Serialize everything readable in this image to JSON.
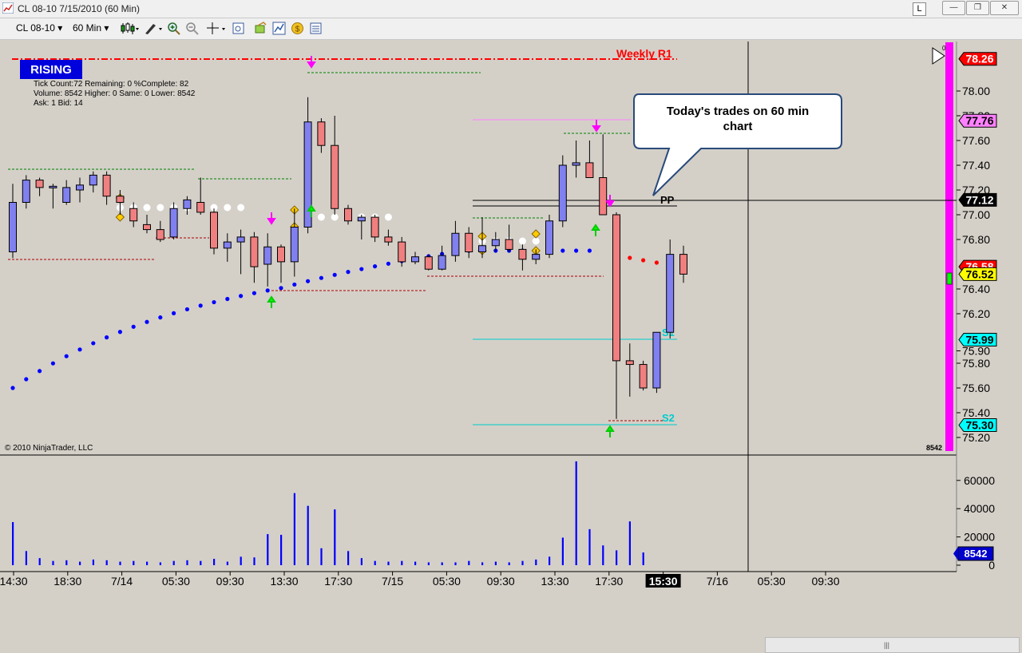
{
  "window": {
    "title": "CL 08-10  7/15/2010 (60 Min)",
    "l_button": "L",
    "minimize": "—",
    "restore": "❐",
    "close": "✕"
  },
  "toolbar": {
    "instrument": "CL 08-10",
    "interval": "60 Min"
  },
  "chart": {
    "rising_label": "RISING",
    "stats": [
      "Tick Count:72   Remaining: 0   %Complete: 82",
      "Volume: 8542   Higher: 0   Same: 0   Lower: 8542",
      "Ask: 1   Bid: 14"
    ],
    "copyright": "© 2010 NinjaTrader, LLC",
    "callout": "Today's trades on 60 min chart",
    "level_labels": {
      "weekly_r1": "Weekly R1",
      "pp": "PP",
      "s1": "S1",
      "s2": "S2"
    },
    "bar_counter": "8542",
    "volume_badge": "8542",
    "price_badges": [
      {
        "text": "78.26",
        "bg": "#ff0000",
        "fg": "#ffffff"
      },
      {
        "text": "77.76",
        "bg": "#ff80ff",
        "fg": "#000000"
      },
      {
        "text": "77.12",
        "bg": "#000000",
        "fg": "#ffffff"
      },
      {
        "text": "76.58",
        "bg": "#ff0000",
        "fg": "#ffffff"
      },
      {
        "text": "76.52",
        "bg": "#ffff00",
        "fg": "#000000"
      },
      {
        "text": "75.99",
        "bg": "#00ffff",
        "fg": "#000000"
      },
      {
        "text": "75.30",
        "bg": "#00ffff",
        "fg": "#000000"
      }
    ],
    "price_ticks": [
      "78.00",
      "77.80",
      "77.60",
      "77.40",
      "77.20",
      "77.00",
      "76.80",
      "76.40",
      "76.20",
      "75.90",
      "75.80",
      "75.60",
      "75.40",
      "75.20"
    ],
    "volume_ticks": [
      "60000",
      "40000",
      "20000",
      "0"
    ],
    "time_ticks": [
      "14:30",
      "18:30",
      "7/14",
      "05:30",
      "09:30",
      "13:30",
      "17:30",
      "7/15",
      "05:30",
      "09:30",
      "13:30",
      "17:30",
      "15:30",
      "7/16",
      "05:30",
      "09:30"
    ],
    "colors": {
      "up_body": "#8080f0",
      "down_body": "#f08080",
      "magenta_bar": "#ff00ff",
      "volume": "#0000ff",
      "psar_blue": "#0000ff",
      "psar_red": "#ff0000"
    }
  },
  "chart_data": {
    "type": "candlestick",
    "instrument": "CL 08-10",
    "interval": "60 Min",
    "candles": [
      {
        "o": 76.7,
        "h": 77.25,
        "l": 76.65,
        "c": 77.1
      },
      {
        "o": 77.1,
        "h": 77.32,
        "l": 77.05,
        "c": 77.28
      },
      {
        "o": 77.28,
        "h": 77.3,
        "l": 77.15,
        "c": 77.22
      },
      {
        "o": 77.22,
        "h": 77.25,
        "l": 77.05,
        "c": 77.23
      },
      {
        "o": 77.1,
        "h": 77.28,
        "l": 77.08,
        "c": 77.22
      },
      {
        "o": 77.2,
        "h": 77.3,
        "l": 77.1,
        "c": 77.24
      },
      {
        "o": 77.24,
        "h": 77.35,
        "l": 77.18,
        "c": 77.32
      },
      {
        "o": 77.32,
        "h": 77.35,
        "l": 77.08,
        "c": 77.15
      },
      {
        "o": 77.15,
        "h": 77.2,
        "l": 77.0,
        "c": 77.1
      },
      {
        "o": 77.05,
        "h": 77.1,
        "l": 76.9,
        "c": 76.95
      },
      {
        "o": 76.92,
        "h": 77.0,
        "l": 76.85,
        "c": 76.88
      },
      {
        "o": 76.88,
        "h": 76.95,
        "l": 76.78,
        "c": 76.8
      },
      {
        "o": 76.82,
        "h": 77.1,
        "l": 76.8,
        "c": 77.05
      },
      {
        "o": 77.05,
        "h": 77.15,
        "l": 77.0,
        "c": 77.12
      },
      {
        "o": 77.1,
        "h": 77.3,
        "l": 77.0,
        "c": 77.02
      },
      {
        "o": 77.02,
        "h": 77.05,
        "l": 76.68,
        "c": 76.73
      },
      {
        "o": 76.73,
        "h": 76.85,
        "l": 76.62,
        "c": 76.78
      },
      {
        "o": 76.78,
        "h": 76.88,
        "l": 76.52,
        "c": 76.82
      },
      {
        "o": 76.82,
        "h": 76.86,
        "l": 76.45,
        "c": 76.58
      },
      {
        "o": 76.6,
        "h": 76.85,
        "l": 76.42,
        "c": 76.74
      },
      {
        "o": 76.74,
        "h": 76.76,
        "l": 76.45,
        "c": 76.62
      },
      {
        "o": 76.62,
        "h": 77.05,
        "l": 76.5,
        "c": 76.9
      },
      {
        "o": 76.9,
        "h": 77.95,
        "l": 76.85,
        "c": 77.75
      },
      {
        "o": 77.75,
        "h": 77.78,
        "l": 77.5,
        "c": 77.56
      },
      {
        "o": 77.56,
        "h": 77.8,
        "l": 77.0,
        "c": 77.05
      },
      {
        "o": 77.05,
        "h": 77.08,
        "l": 76.92,
        "c": 76.95
      },
      {
        "o": 76.95,
        "h": 77.0,
        "l": 76.8,
        "c": 76.98
      },
      {
        "o": 76.98,
        "h": 77.0,
        "l": 76.78,
        "c": 76.82
      },
      {
        "o": 76.82,
        "h": 76.88,
        "l": 76.75,
        "c": 76.78
      },
      {
        "o": 76.78,
        "h": 76.82,
        "l": 76.58,
        "c": 76.62
      },
      {
        "o": 76.62,
        "h": 76.7,
        "l": 76.6,
        "c": 76.66
      },
      {
        "o": 76.66,
        "h": 76.68,
        "l": 76.55,
        "c": 76.56
      },
      {
        "o": 76.56,
        "h": 76.75,
        "l": 76.55,
        "c": 76.67
      },
      {
        "o": 76.67,
        "h": 76.95,
        "l": 76.62,
        "c": 76.85
      },
      {
        "o": 76.85,
        "h": 76.9,
        "l": 76.65,
        "c": 76.7
      },
      {
        "o": 76.7,
        "h": 76.98,
        "l": 76.65,
        "c": 76.75
      },
      {
        "o": 76.75,
        "h": 76.86,
        "l": 76.7,
        "c": 76.8
      },
      {
        "o": 76.8,
        "h": 76.92,
        "l": 76.7,
        "c": 76.72
      },
      {
        "o": 76.72,
        "h": 76.76,
        "l": 76.55,
        "c": 76.64
      },
      {
        "o": 76.64,
        "h": 76.72,
        "l": 76.6,
        "c": 76.68
      },
      {
        "o": 76.68,
        "h": 77.0,
        "l": 76.65,
        "c": 76.95
      },
      {
        "o": 76.95,
        "h": 77.48,
        "l": 76.9,
        "c": 77.4
      },
      {
        "o": 77.4,
        "h": 77.6,
        "l": 77.3,
        "c": 77.42
      },
      {
        "o": 77.42,
        "h": 77.6,
        "l": 77.3,
        "c": 77.3
      },
      {
        "o": 77.3,
        "h": 77.65,
        "l": 77.0,
        "c": 77.0
      },
      {
        "o": 77.0,
        "h": 77.02,
        "l": 75.35,
        "c": 75.82
      },
      {
        "o": 75.82,
        "h": 75.96,
        "l": 75.53,
        "c": 75.79
      },
      {
        "o": 75.79,
        "h": 75.82,
        "l": 75.58,
        "c": 75.6
      },
      {
        "o": 75.6,
        "h": 76.05,
        "l": 75.56,
        "c": 76.05
      },
      {
        "o": 76.05,
        "h": 76.8,
        "l": 76.0,
        "c": 76.68
      },
      {
        "o": 76.68,
        "h": 76.75,
        "l": 76.45,
        "c": 76.52
      }
    ],
    "volume": [
      30500,
      10000,
      5000,
      3000,
      3500,
      2500,
      4000,
      3500,
      2500,
      3000,
      2500,
      2000,
      3000,
      3500,
      3000,
      4500,
      2500,
      6000,
      5500,
      22000,
      21500,
      51000,
      42000,
      12000,
      39500,
      10000,
      5000,
      3000,
      2500,
      3000,
      2500,
      2000,
      2000,
      2000,
      3000,
      2000,
      2500,
      2000,
      3000,
      4000,
      6000,
      19500,
      73500,
      25500,
      14000,
      10500,
      31000,
      9000
    ],
    "levels": {
      "weekly_r1": 78.26,
      "pp": 77.07,
      "s1": 75.99,
      "s2": 75.3
    },
    "price_axis": [
      75.1,
      78.34
    ],
    "volume_axis": [
      0,
      70000
    ]
  }
}
